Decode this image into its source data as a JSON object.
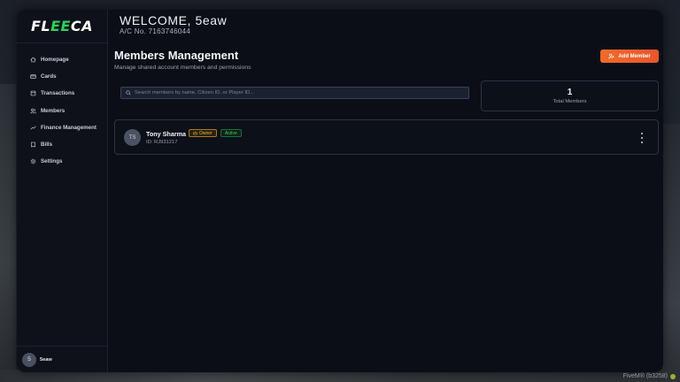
{
  "brand": {
    "logo_prefix": "FL",
    "logo_accent": "EE",
    "logo_suffix": "CA",
    "accent_color": "#28d35a"
  },
  "header": {
    "welcome": "WELCOME, 5eaw",
    "account": "A/C No. 7163746044"
  },
  "sidebar": {
    "items": [
      {
        "label": "Homepage",
        "icon": "home-icon"
      },
      {
        "label": "Cards",
        "icon": "card-icon"
      },
      {
        "label": "Transactions",
        "icon": "transactions-icon"
      },
      {
        "label": "Members",
        "icon": "members-icon"
      },
      {
        "label": "Finance Management",
        "icon": "trend-icon"
      },
      {
        "label": "Bills",
        "icon": "bills-icon"
      },
      {
        "label": "Settings",
        "icon": "gear-icon"
      }
    ],
    "user": {
      "initial": "5",
      "name": "5eaw"
    }
  },
  "page": {
    "title": "Members Management",
    "subtitle": "Manage shared account members and permissions",
    "add_button": "Add Member",
    "add_button_color": "#f0622a"
  },
  "search": {
    "placeholder": "Search members by name, Citizen ID, or Player ID..."
  },
  "stats": {
    "value": "1",
    "label": "Total Members"
  },
  "members": [
    {
      "initials": "TS",
      "name": "Tony Sharma",
      "role": "Owner",
      "status": "Active",
      "id_text": "ID: RJ931217"
    }
  ],
  "overlay": {
    "fivem_text": "FiveM® (b3258)"
  }
}
